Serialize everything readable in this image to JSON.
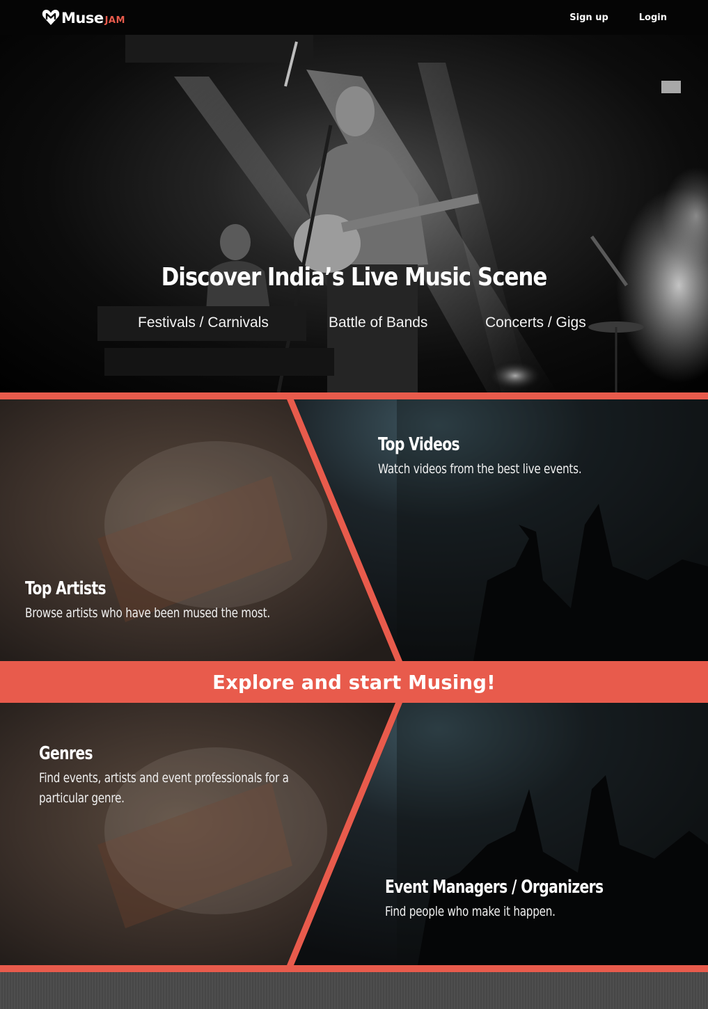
{
  "navbar": {
    "logo": {
      "muse": "Muse",
      "jam": "JAM"
    },
    "signup_label": "Sign up",
    "login_label": "Login"
  },
  "hero": {
    "title": "Discover India’s Live Music Scene",
    "links": [
      "Festivals / Carnivals",
      "Battle of Bands",
      "Concerts / Gigs"
    ]
  },
  "panels": {
    "top_artists": {
      "title": "Top Artists",
      "description": "Browse artists who have been mused the most."
    },
    "top_videos": {
      "title": "Top Videos",
      "description": "Watch videos from the best live events."
    },
    "explore_banner": "Explore and start Musing!",
    "genres": {
      "title": "Genres",
      "description": "Find events, artists and event professionals for a particular genre."
    },
    "event_managers": {
      "title": "Event Managers / Organizers",
      "description": "Find people who make it happen."
    }
  },
  "colors": {
    "accent": "#e85b4c",
    "navbar": "#050505",
    "footer": "#4c4c4c"
  }
}
